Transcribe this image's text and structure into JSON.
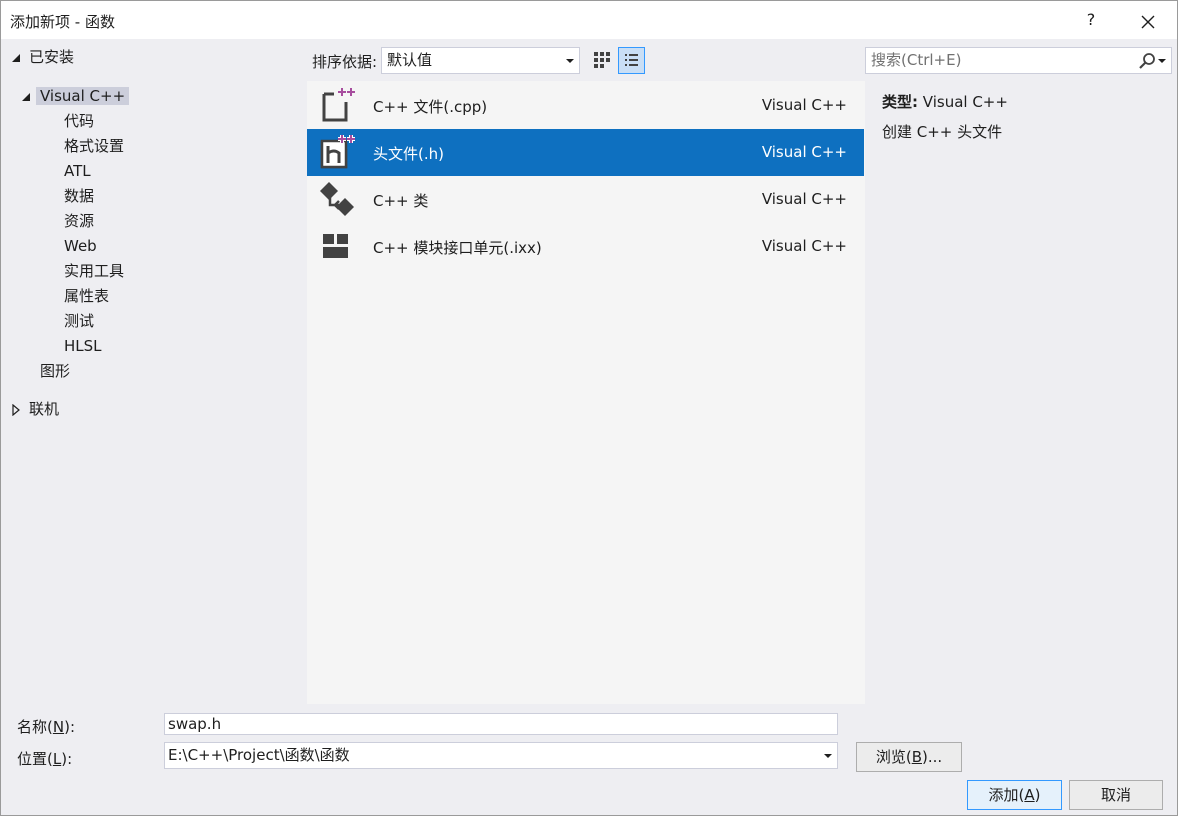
{
  "window": {
    "title": "添加新项 - 函数",
    "help_label": "?",
    "close_label": "✕"
  },
  "tree": {
    "installed": "已安装",
    "visual_cpp": "Visual C++",
    "children": [
      "代码",
      "格式设置",
      "ATL",
      "数据",
      "资源",
      "Web",
      "实用工具",
      "属性表",
      "测试",
      "HLSL"
    ],
    "graphics": "图形",
    "online": "联机"
  },
  "toolbar": {
    "sort_label": "排序依据:",
    "sort_value": "默认值"
  },
  "search": {
    "placeholder": "搜索(Ctrl+E)"
  },
  "list": {
    "items": [
      {
        "name": "C++ 文件(.cpp)",
        "type": "Visual C++",
        "icon": "cpp-file-icon"
      },
      {
        "name": "头文件(.h)",
        "type": "Visual C++",
        "icon": "header-file-icon"
      },
      {
        "name": "C++ 类",
        "type": "Visual C++",
        "icon": "cpp-class-icon"
      },
      {
        "name": "C++ 模块接口单元(.ixx)",
        "type": "Visual C++",
        "icon": "module-interface-icon"
      }
    ],
    "selected_index": 1
  },
  "details": {
    "type_label": "类型:",
    "type_value": "Visual C++",
    "description": "创建 C++ 头文件"
  },
  "form": {
    "name_label_pre": "名称(",
    "name_label_key": "N",
    "name_label_post": "):",
    "name_value": "swap.h",
    "location_label_pre": "位置(",
    "location_label_key": "L",
    "location_label_post": "):",
    "location_value": "E:\\C++\\Project\\函数\\函数",
    "browse_pre": "浏览(",
    "browse_key": "B",
    "browse_post": ")...",
    "add_pre": "添加(",
    "add_key": "A",
    "add_post": ")",
    "cancel_label": "取消"
  },
  "colors": {
    "selection": "#0e70c0",
    "background": "#eeeef2",
    "list_background": "#f5f5f5",
    "accent": "#3399ff"
  }
}
